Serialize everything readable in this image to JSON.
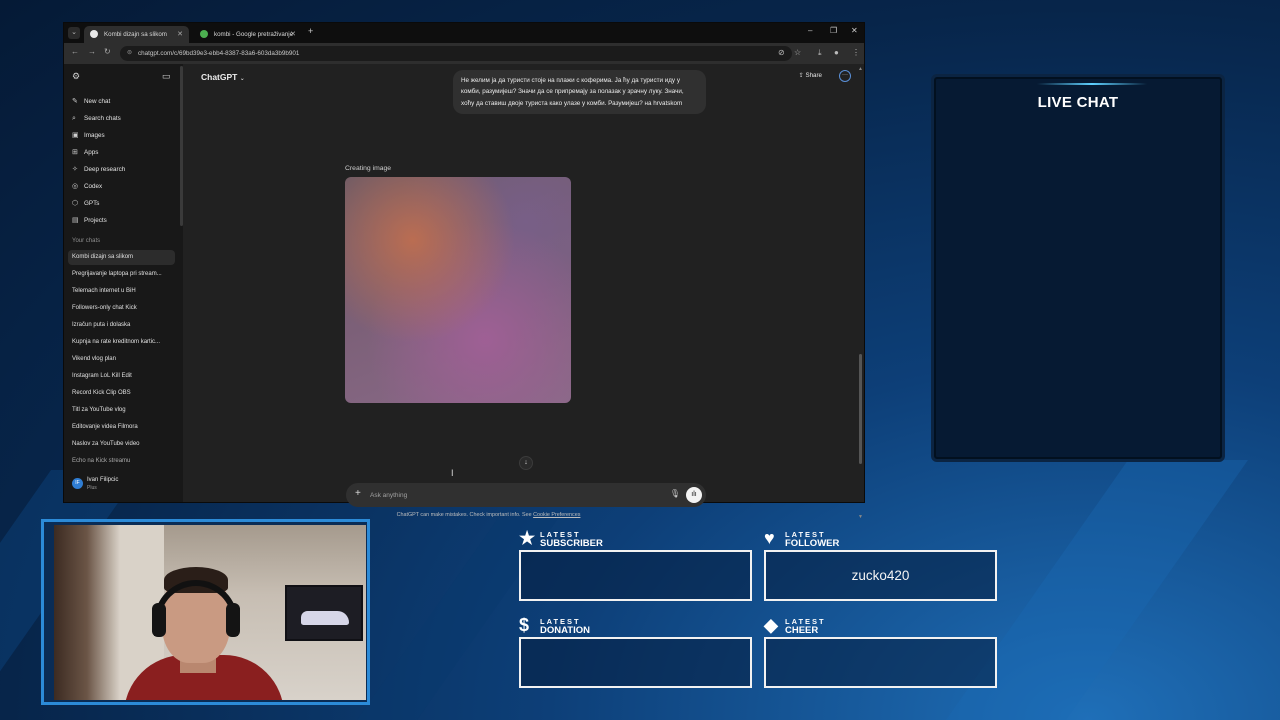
{
  "browser": {
    "tabs": [
      {
        "title": "Kombi dizajn sa slikom",
        "active": true
      },
      {
        "title": "kombi - Google pretraživanje",
        "active": false
      }
    ],
    "url": "chatgpt.com/c/69bd39e3-ebb4-8387-83a6-603da3b9b901"
  },
  "sidebar": {
    "nav": [
      {
        "label": "New chat",
        "icon": "edit-icon"
      },
      {
        "label": "Search chats",
        "icon": "search-icon"
      },
      {
        "label": "Images",
        "icon": "image-icon"
      },
      {
        "label": "Apps",
        "icon": "apps-icon"
      },
      {
        "label": "Deep research",
        "icon": "research-icon"
      },
      {
        "label": "Codex",
        "icon": "codex-icon"
      },
      {
        "label": "GPTs",
        "icon": "gpts-icon"
      },
      {
        "label": "Projects",
        "icon": "folder-icon"
      }
    ],
    "section_title": "Your chats",
    "chats": [
      "Kombi dizajn sa slikom",
      "Pregrijavanje laptopa pri stream...",
      "Telemach internet u BiH",
      "Followers-only chat Kick",
      "Izračun puta i dolaska",
      "Kupnja na rate kreditnom kartic...",
      "Vikend vlog plan",
      "Instagram LoL Kill Edit",
      "Record Kick Clip OBS",
      "Titl za YouTube vlog",
      "Editovanje videa Filmora",
      "Naslov za YouTube video",
      "Echo na Kick streamu"
    ],
    "user": {
      "name": "Ivan Filipcic",
      "plan": "Plus",
      "initials": "IF"
    }
  },
  "main": {
    "model": "ChatGPT",
    "share_label": "Share",
    "user_message": "Не желим ја да туристи стоје на плажи с коферима. Ја ћу да туристи иду у комби, разумијеш? Значи да се припремају за полазак у зрачну луку. Значи, хоћу да ставиш двоје туриста како улазе у комби. Разумијеш? на hrvatskom",
    "creating_label": "Creating image",
    "composer_placeholder": "Ask anything",
    "disclaimer": "ChatGPT can make mistakes. Check important info. See",
    "disclaimer_link": "Cookie Preferences"
  },
  "overlay": {
    "live_chat_title": "LIVE CHAT",
    "alerts": [
      {
        "small": "LATEST",
        "big": "SUBSCRIBER",
        "icon": "star-icon",
        "value": ""
      },
      {
        "small": "LATEST",
        "big": "FOLLOWER",
        "icon": "heart-icon",
        "value": "zucko420"
      },
      {
        "small": "LATEST",
        "big": "DONATION",
        "icon": "dollar-icon",
        "value": ""
      },
      {
        "small": "LATEST",
        "big": "CHEER",
        "icon": "diamond-icon",
        "value": ""
      }
    ],
    "colors": {
      "accent": "#2c8bd8",
      "panel": "#061a33"
    }
  }
}
